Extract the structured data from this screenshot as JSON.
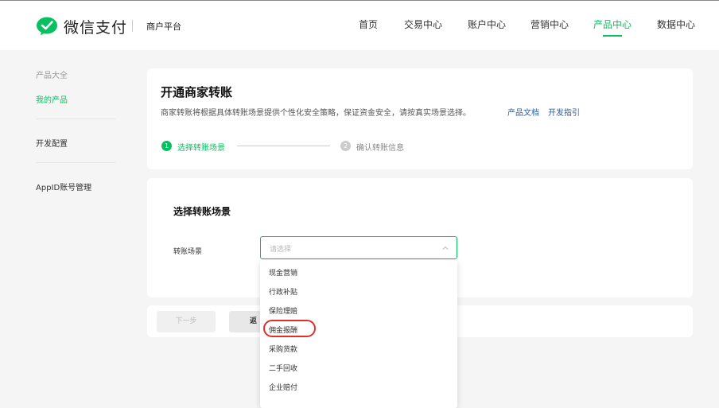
{
  "header": {
    "brand": "微信支付",
    "platform": "商户平台",
    "nav": [
      {
        "label": "首页"
      },
      {
        "label": "交易中心"
      },
      {
        "label": "账户中心"
      },
      {
        "label": "营销中心"
      },
      {
        "label": "产品中心"
      },
      {
        "label": "数据中心"
      }
    ],
    "active_nav": "产品中心"
  },
  "sidebar": {
    "heading": "产品大全",
    "items": [
      {
        "label": "我的产品"
      },
      {
        "label": "开发配置"
      },
      {
        "label": "AppID账号管理"
      }
    ]
  },
  "main": {
    "title": "开通商家转账",
    "description": "商家转账将根据具体转账场景提供个性化安全策略，保证资金安全，请按真实场景选择。",
    "links": [
      "产品文档",
      "开发指引"
    ],
    "steps": [
      {
        "num": "1",
        "label": "选择转账场景"
      },
      {
        "num": "2",
        "label": "确认转账信息"
      }
    ],
    "section_title": "选择转账场景",
    "field_label": "转账场景",
    "select": {
      "placeholder": "请选择"
    },
    "buttons": {
      "next": "下一步",
      "back": "返"
    }
  },
  "dropdown": {
    "options": [
      "现金营销",
      "行政补贴",
      "保险理赔",
      "佣金报酬",
      "采购货款",
      "二手回收",
      "企业赔付"
    ],
    "highlighted": "佣金报酬"
  },
  "colors": {
    "accent": "#07c160",
    "link": "#2e5e9c",
    "highlight": "#e0302a"
  }
}
